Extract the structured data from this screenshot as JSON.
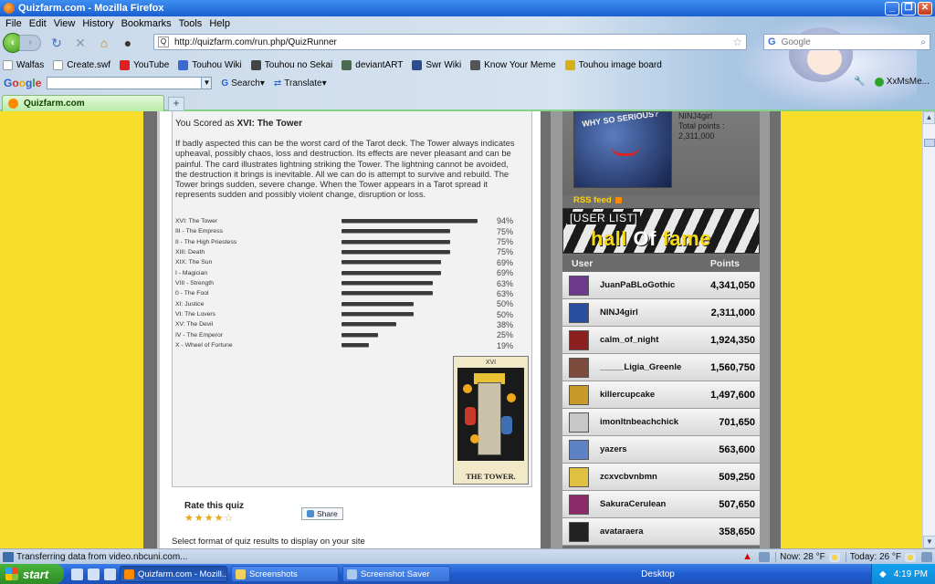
{
  "window": {
    "title": "Quizfarm.com - Mozilla Firefox"
  },
  "menu": [
    "File",
    "Edit",
    "View",
    "History",
    "Bookmarks",
    "Tools",
    "Help"
  ],
  "nav": {
    "url": "http://quizfarm.com/run.php/QuizRunner",
    "search_placeholder": "Google"
  },
  "bookmarks": [
    "Walfas",
    "Create.swf",
    "YouTube",
    "Touhou Wiki",
    "Touhou no Sekai",
    "deviantART",
    "Swr Wiki",
    "Know Your Meme",
    "Touhou image board"
  ],
  "google_toolbar": {
    "logo": "Google",
    "search_label": "Search",
    "translate_label": "Translate",
    "user_label": "XxMsMe..."
  },
  "tab": {
    "label": "Quizfarm.com"
  },
  "quiz": {
    "scored_prefix": "You Scored as ",
    "scored_result": "XVI: The Tower",
    "description": "If badly aspected this can be the worst card of the Tarot deck. The Tower always indicates upheaval, possibly chaos, loss and destruction. Its effects are never pleasant and can be painful. The card illustrates lightning striking the Tower. The lightning cannot be avoided, the destruction it brings is inevitable. All we can do is attempt to survive and rebuild. The Tower brings sudden, severe change. When the Tower appears in a Tarot spread it represents sudden and possibly violent change, disruption or loss.",
    "results": [
      {
        "label": "XVI: The Tower",
        "pct": 94,
        "text": "94%"
      },
      {
        "label": "III - The Empress",
        "pct": 75,
        "text": "75%"
      },
      {
        "label": "II - The High Priestess",
        "pct": 75,
        "text": "75%"
      },
      {
        "label": "XIII: Death",
        "pct": 75,
        "text": "75%"
      },
      {
        "label": "XIX: The Sun",
        "pct": 69,
        "text": "69%"
      },
      {
        "label": "I - Magician",
        "pct": 69,
        "text": "69%"
      },
      {
        "label": "VIII - Strength",
        "pct": 63,
        "text": "63%"
      },
      {
        "label": "0 - The Fool",
        "pct": 63,
        "text": "63%"
      },
      {
        "label": "XI: Justice",
        "pct": 50,
        "text": "50%"
      },
      {
        "label": "VI: The Lovers",
        "pct": 50,
        "text": "50%"
      },
      {
        "label": "XV: The Devil",
        "pct": 38,
        "text": "38%"
      },
      {
        "label": "IV - The Emperor",
        "pct": 25,
        "text": "25%"
      },
      {
        "label": "X - Wheel of Fortune",
        "pct": 19,
        "text": "19%"
      }
    ],
    "card": {
      "numeral": "XVI",
      "name": "THE TOWER."
    },
    "rate_label": "Rate this quiz",
    "rating": 4,
    "share_label": "Share",
    "select_format": "Select format of quiz results to display on your site"
  },
  "sidebar": {
    "avatar_text": "WHY SO SERIOUS?",
    "user": {
      "name": "NINJ4girl",
      "points_label": "Total points :",
      "points": "2,311,000"
    },
    "rss": "RSS feed",
    "hof_small": "[USER LIST]",
    "hof_a": "hall ",
    "hof_o": "Of",
    "hof_b": " fame",
    "col_user": "User",
    "col_points": "Points",
    "leaderboard": [
      {
        "name": "JuanPaBLoGothic",
        "points": "4,341,050",
        "color": "#6b3a8a"
      },
      {
        "name": "NINJ4girl",
        "points": "2,311,000",
        "color": "#274f9e"
      },
      {
        "name": "calm_of_night",
        "points": "1,924,350",
        "color": "#8c1f1f"
      },
      {
        "name": "_____Ligia_Greenle",
        "points": "1,560,750",
        "color": "#7c4b3b"
      },
      {
        "name": "killercupcake",
        "points": "1,497,600",
        "color": "#c79a2a"
      },
      {
        "name": "imonltnbeachchick",
        "points": "701,650",
        "color": "#c7c7c7"
      },
      {
        "name": "yazers",
        "points": "563,600",
        "color": "#5d82c6"
      },
      {
        "name": "zcxvcbvnbmn",
        "points": "509,250",
        "color": "#e0c040"
      },
      {
        "name": "SakuraCerulean",
        "points": "507,650",
        "color": "#8c2a6a"
      },
      {
        "name": "avataraera",
        "points": "358,650",
        "color": "#222222"
      }
    ]
  },
  "status": {
    "text": "Transferring data from video.nbcuni.com...",
    "now": "Now: 28 °F",
    "today": "Today: 26 °F"
  },
  "taskbar": {
    "start": "start",
    "windows": [
      "Quizfarm.com - Mozill...",
      "Screenshots",
      "Screenshot Saver"
    ],
    "desktop": "Desktop",
    "time": "4:19 PM"
  }
}
